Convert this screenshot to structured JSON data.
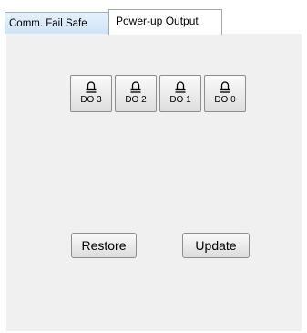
{
  "tabs": [
    {
      "label": "Comm. Fail Safe",
      "active": false
    },
    {
      "label": "Power-up Output",
      "active": true
    }
  ],
  "outputs": [
    {
      "label": "DO 3",
      "icon": "bell-icon"
    },
    {
      "label": "DO 2",
      "icon": "bell-icon"
    },
    {
      "label": "DO 1",
      "icon": "bell-icon"
    },
    {
      "label": "DO 0",
      "icon": "bell-icon"
    }
  ],
  "actions": {
    "restore_label": "Restore",
    "update_label": "Update"
  },
  "colors": {
    "inactive_tab": "#cfe4f7",
    "panel_background": "#f0f0f0"
  }
}
